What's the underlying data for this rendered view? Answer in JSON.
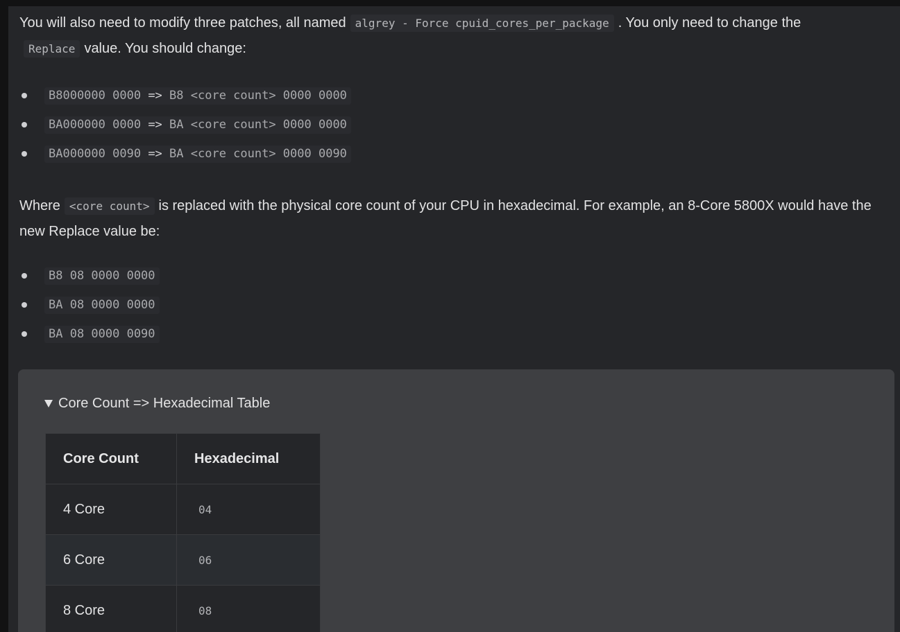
{
  "intro": {
    "text_before": "You will also need to modify three patches, all named",
    "patch_name": "algrey - Force cpuid_cores_per_package",
    "text_middle": ". You only need to change the",
    "field_name": "Replace",
    "text_after": "value. You should change:"
  },
  "changes": [
    {
      "from": "B8000000 0000",
      "arrow": "=>",
      "to": "B8 <core count> 0000 0000"
    },
    {
      "from": "BA000000 0000",
      "arrow": "=>",
      "to": "BA <core count> 0000 0000"
    },
    {
      "from": "BA000000 0090",
      "arrow": "=>",
      "to": "BA <core count> 0000 0090"
    }
  ],
  "explanation": {
    "text_before": "Where",
    "placeholder": "<core count>",
    "text_after": "is replaced with the physical core count of your CPU in hexadecimal. For example, an 8-Core 5800X would have the new Replace value be:"
  },
  "examples": [
    "B8 08 0000 0000",
    "BA 08 0000 0000",
    "BA 08 0000 0090"
  ],
  "details": {
    "summary": "Core Count => Hexadecimal Table",
    "table": {
      "headers": [
        "Core Count",
        "Hexadecimal"
      ],
      "rows": [
        {
          "cores": "4 Core",
          "hex": "04"
        },
        {
          "cores": "6 Core",
          "hex": "06"
        },
        {
          "cores": "8 Core",
          "hex": "08"
        }
      ]
    }
  }
}
